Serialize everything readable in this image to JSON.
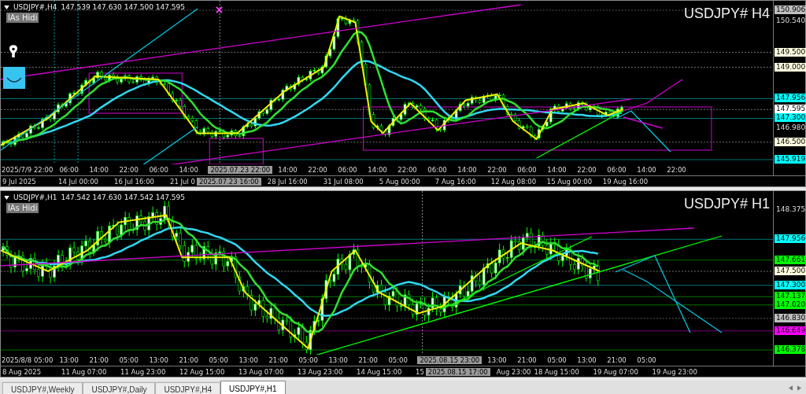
{
  "charts": [
    {
      "header": {
        "symbol": "USDJPY#,H4",
        "ohlc": "147.539 147.630 147.500 147.595"
      },
      "button": "lAs Hidi",
      "title": "USDJPY# H4",
      "price_labels": [
        {
          "text": "150.906",
          "kind": "tag",
          "color": "#c0c0c0"
        },
        {
          "text": "150.540",
          "kind": "tick"
        },
        {
          "text": "149.500",
          "kind": "tag",
          "color": "#fffde0"
        },
        {
          "text": "149.000",
          "kind": "tag",
          "color": "#fffde0"
        },
        {
          "text": "147.956",
          "kind": "tag",
          "color": "#00ffff"
        },
        {
          "text": "147.595",
          "kind": "tag",
          "color": "#ffffff"
        },
        {
          "text": "147.300",
          "kind": "tag",
          "color": "#00ffff"
        },
        {
          "text": "146.980",
          "kind": "tick"
        },
        {
          "text": "146.500",
          "kind": "tag",
          "color": "#fffde0"
        },
        {
          "text": "145.919",
          "kind": "tag",
          "color": "#00ffff"
        }
      ],
      "inner_time_labels": [
        {
          "text": "2025/7/9 22:00",
          "kind": "start"
        },
        {
          "text": "06:00",
          "kind": "tick"
        },
        {
          "text": "14:00",
          "kind": "tick"
        },
        {
          "text": "22:00",
          "kind": "tick"
        },
        {
          "text": "06:00",
          "kind": "tick"
        },
        {
          "text": "14:00",
          "kind": "tick"
        },
        {
          "text": "2025.07.23 22:00",
          "kind": "cursor"
        },
        {
          "text": "14:00",
          "kind": "tick"
        },
        {
          "text": "22:00",
          "kind": "tick"
        },
        {
          "text": "06:00",
          "kind": "tick"
        },
        {
          "text": "14:00",
          "kind": "tick"
        },
        {
          "text": "22:00",
          "kind": "tick"
        },
        {
          "text": "06:00",
          "kind": "tick"
        },
        {
          "text": "14:00",
          "kind": "tick"
        },
        {
          "text": "22:00",
          "kind": "tick"
        },
        {
          "text": "06:00",
          "kind": "tick"
        },
        {
          "text": "14:00",
          "kind": "tick"
        },
        {
          "text": "22:00",
          "kind": "tick"
        },
        {
          "text": "06:00",
          "kind": "tick"
        },
        {
          "text": "14:00",
          "kind": "tick"
        },
        {
          "text": "22:00",
          "kind": "tick"
        }
      ],
      "time_labels": [
        {
          "text": "9 Jul 2025",
          "kind": "tick"
        },
        {
          "text": "14 Jul 00:00",
          "kind": "tick"
        },
        {
          "text": "16 Jul 16:00",
          "kind": "tick"
        },
        {
          "text": "21 Jul 0",
          "kind": "start"
        },
        {
          "text": "2025.07.23 16:00",
          "kind": "cursor"
        },
        {
          "text": "28 Jul 16:00",
          "kind": "tick"
        },
        {
          "text": "31 Jul 08:00",
          "kind": "tick"
        },
        {
          "text": "5 Aug 00:00",
          "kind": "tick"
        },
        {
          "text": "7 Aug 16:00",
          "kind": "tick"
        },
        {
          "text": "12 Aug 08:00",
          "kind": "tick"
        },
        {
          "text": "15 Aug 00:00",
          "kind": "tick"
        },
        {
          "text": "19 Aug 16:00",
          "kind": "tick"
        }
      ]
    },
    {
      "header": {
        "symbol": "USDJPY#,H1",
        "ohlc": "147.542 147.630 147.542 147.595"
      },
      "button": "lAs Hidi",
      "title": "USDJPY# H1",
      "price_labels": [
        {
          "text": "148.375",
          "kind": "tick"
        },
        {
          "text": "147.956",
          "kind": "tag",
          "color": "#00ffff"
        },
        {
          "text": "147.661",
          "kind": "tag",
          "color": "#00ff00"
        },
        {
          "text": "147.500",
          "kind": "tag",
          "color": "#fffde0"
        },
        {
          "text": "147.300",
          "kind": "tag",
          "color": "#00ffff"
        },
        {
          "text": "147.137",
          "kind": "tag",
          "color": "#00ff00"
        },
        {
          "text": "147.020",
          "kind": "tag",
          "color": "#00ff00"
        },
        {
          "text": "146.830",
          "kind": "tag",
          "color": "#c0c0c0"
        },
        {
          "text": "146.649",
          "kind": "tag",
          "color": "#ff00ff"
        },
        {
          "text": "146.378",
          "kind": "tag",
          "color": "#00ff00"
        }
      ],
      "inner_time_labels": [
        {
          "text": "2025/8/8 05:00",
          "kind": "start"
        },
        {
          "text": "13:00",
          "kind": "tick"
        },
        {
          "text": "21:00",
          "kind": "tick"
        },
        {
          "text": "05:00",
          "kind": "tick"
        },
        {
          "text": "13:00",
          "kind": "tick"
        },
        {
          "text": "21:00",
          "kind": "tick"
        },
        {
          "text": "05:00",
          "kind": "tick"
        },
        {
          "text": "13:00",
          "kind": "tick"
        },
        {
          "text": "21:00",
          "kind": "tick"
        },
        {
          "text": "05:00",
          "kind": "tick"
        },
        {
          "text": "13:00",
          "kind": "tick"
        },
        {
          "text": "21:00",
          "kind": "tick"
        },
        {
          "text": "05:00",
          "kind": "tick"
        },
        {
          "text": "2025.08.15 23:00",
          "kind": "cursor"
        },
        {
          "text": "13:00",
          "kind": "tick"
        },
        {
          "text": "21:00",
          "kind": "tick"
        },
        {
          "text": "05:00",
          "kind": "tick"
        },
        {
          "text": "13:00",
          "kind": "tick"
        },
        {
          "text": "21:00",
          "kind": "tick"
        },
        {
          "text": "05:00",
          "kind": "tick"
        }
      ],
      "time_labels": [
        {
          "text": "8 Aug 2025",
          "kind": "tick"
        },
        {
          "text": "11 Aug 07:00",
          "kind": "tick"
        },
        {
          "text": "11 Aug 23:00",
          "kind": "tick"
        },
        {
          "text": "12 Aug 15:00",
          "kind": "tick"
        },
        {
          "text": "13 Aug 07:00",
          "kind": "tick"
        },
        {
          "text": "13 Aug 23:00",
          "kind": "tick"
        },
        {
          "text": "14 Aug 15:00",
          "kind": "tick"
        },
        {
          "text": "15",
          "kind": "start"
        },
        {
          "text": "2025.08.15 17:00",
          "kind": "cursor"
        },
        {
          "text": "Aug 23:00",
          "kind": "start"
        },
        {
          "text": "18 Aug 15:00",
          "kind": "tick"
        },
        {
          "text": "19 Aug 07:00",
          "kind": "tick"
        },
        {
          "text": "19 Aug 23:00",
          "kind": "tick"
        }
      ]
    }
  ],
  "tabs": [
    {
      "label": "USDJPY#,Weekly",
      "selected": false
    },
    {
      "label": "USDJPY#,Daily",
      "selected": false
    },
    {
      "label": "USDJPY#,H4",
      "selected": false
    },
    {
      "label": "USDJPY#,H1",
      "selected": true
    }
  ]
}
